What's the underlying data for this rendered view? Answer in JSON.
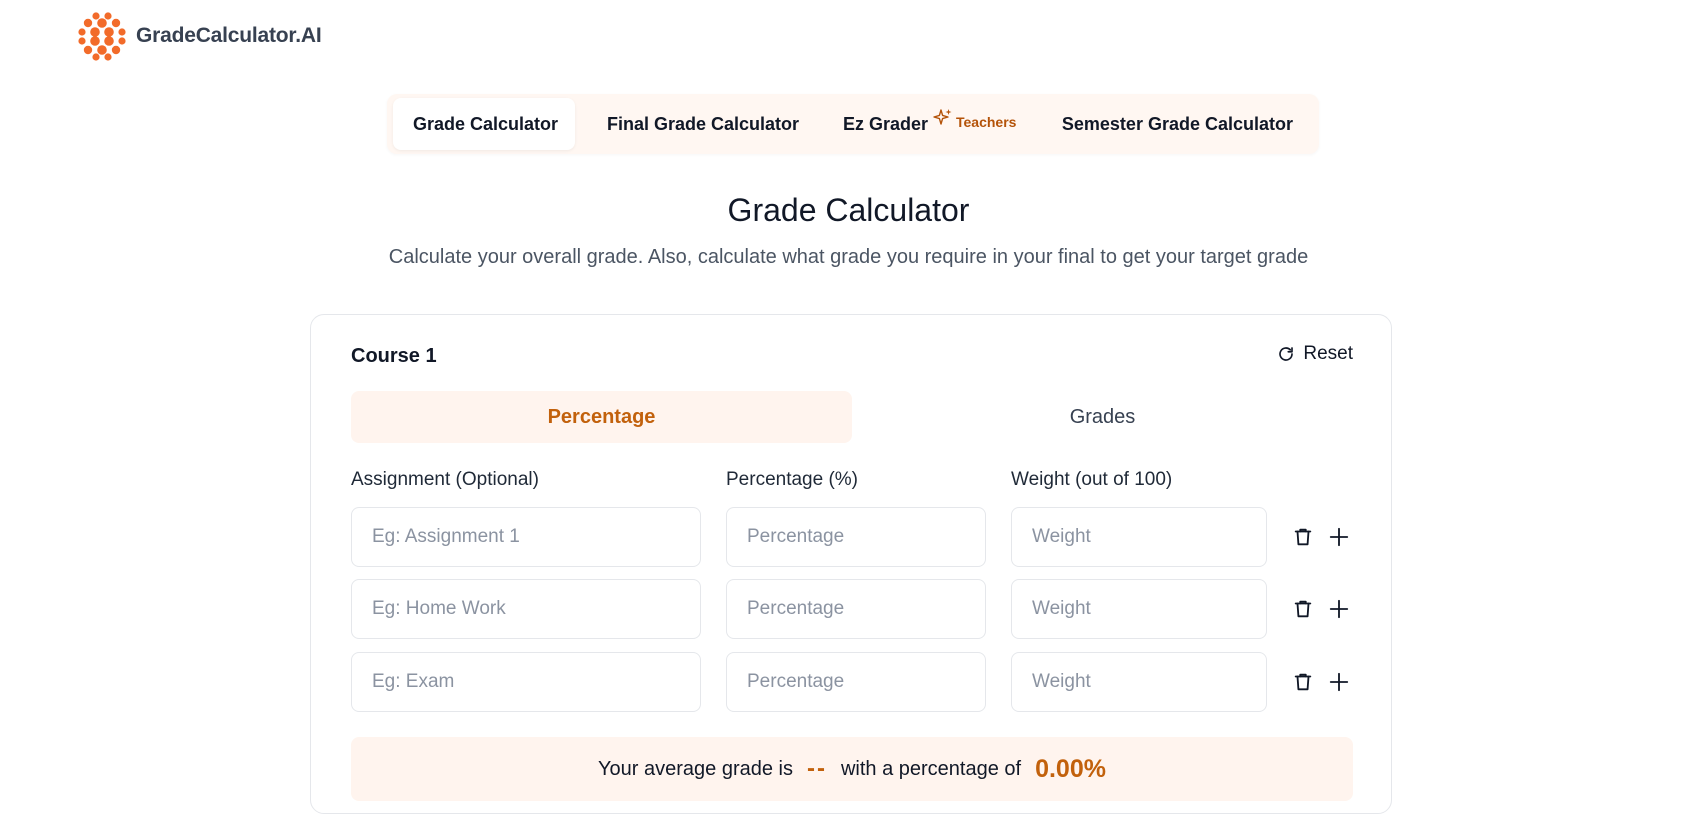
{
  "brand": {
    "name": "GradeCalculator.AI"
  },
  "nav": {
    "tabs": [
      {
        "label": "Grade Calculator",
        "active": true
      },
      {
        "label": "Final Grade Calculator",
        "active": false
      },
      {
        "label": "Ez Grader",
        "badge": "Teachers",
        "active": false
      },
      {
        "label": "Semester Grade Calculator",
        "active": false
      }
    ]
  },
  "page": {
    "title": "Grade Calculator",
    "subtitle": "Calculate your overall grade. Also, calculate what grade you require in your final to get your target grade"
  },
  "course": {
    "title": "Course 1",
    "reset_label": "Reset",
    "modes": [
      {
        "label": "Percentage",
        "active": true
      },
      {
        "label": "Grades",
        "active": false
      }
    ],
    "columns": {
      "assignment": "Assignment (Optional)",
      "percentage": "Percentage (%)",
      "weight": "Weight (out of 100)"
    },
    "rows": [
      {
        "assignment_placeholder": "Eg: Assignment 1",
        "percentage_placeholder": "Percentage",
        "weight_placeholder": "Weight"
      },
      {
        "assignment_placeholder": "Eg: Home Work",
        "percentage_placeholder": "Percentage",
        "weight_placeholder": "Weight"
      },
      {
        "assignment_placeholder": "Eg: Exam",
        "percentage_placeholder": "Percentage",
        "weight_placeholder": "Weight"
      }
    ],
    "result": {
      "prefix": "Your average grade is",
      "grade": "--",
      "middle": "with a percentage of",
      "percentage": "0.00%"
    }
  },
  "colors": {
    "accent": "#c2610c",
    "accent_bg": "#fff4ee",
    "logo": "#f26b2a"
  },
  "icons": [
    "logo-dots-icon",
    "sparkle-icon",
    "refresh-icon",
    "trash-icon",
    "plus-icon"
  ]
}
